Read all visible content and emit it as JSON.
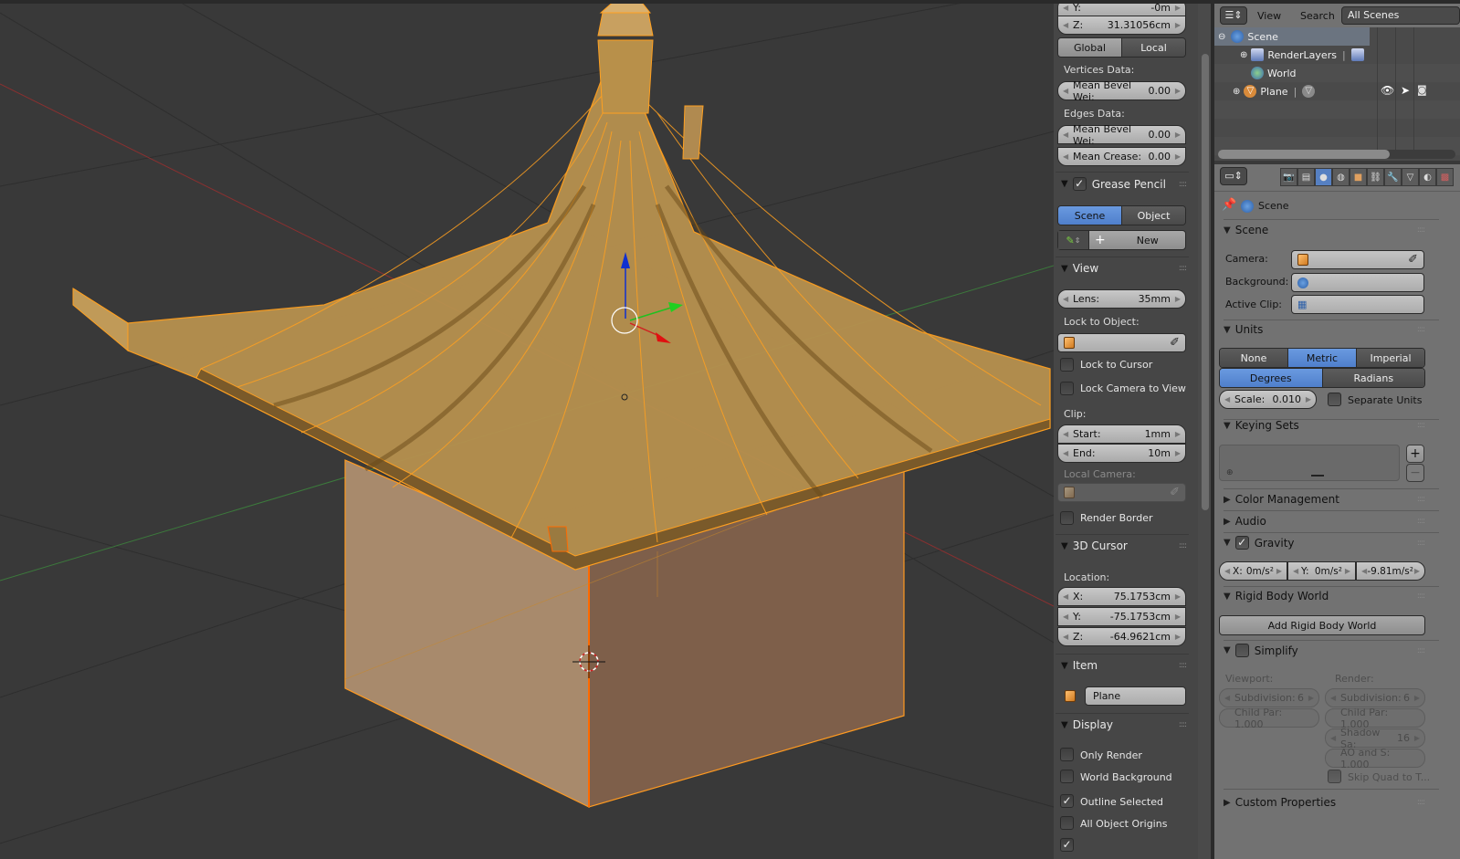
{
  "npanel": {
    "transform": {
      "y_label": "Y:",
      "y_value": "-0m",
      "z_label": "Z:",
      "z_value": "31.31056cm",
      "space_options": [
        "Global",
        "Local"
      ],
      "space_selected": "Local",
      "vertices_data_label": "Vertices Data:",
      "vertex_mean_bevel_label": "Mean Bevel Wei:",
      "vertex_mean_bevel_value": "0.00",
      "edges_data_label": "Edges Data:",
      "edge_mean_bevel_label": "Mean Bevel Wei:",
      "edge_mean_bevel_value": "0.00",
      "mean_crease_label": "Mean Crease:",
      "mean_crease_value": "0.00"
    },
    "grease_pencil": {
      "title": "Grease Pencil",
      "enabled": true,
      "source_options": [
        "Scene",
        "Object"
      ],
      "source_selected": "Scene",
      "new_label": "New"
    },
    "view": {
      "title": "View",
      "lens_label": "Lens:",
      "lens_value": "35mm",
      "lock_to_object_label": "Lock to Object:",
      "lock_to_cursor_label": "Lock to Cursor",
      "lock_to_cursor": false,
      "lock_camera_label": "Lock Camera to View",
      "lock_camera": false,
      "clip_label": "Clip:",
      "clip_start_label": "Start:",
      "clip_start_value": "1mm",
      "clip_end_label": "End:",
      "clip_end_value": "10m",
      "local_camera_label": "Local Camera:",
      "render_border_label": "Render Border",
      "render_border": false
    },
    "cursor": {
      "title": "3D Cursor",
      "location_label": "Location:",
      "x_label": "X:",
      "x_value": "75.1753cm",
      "y_label": "Y:",
      "y_value": "-75.1753cm",
      "z_label": "Z:",
      "z_value": "-64.9621cm"
    },
    "item": {
      "title": "Item",
      "name": "Plane"
    },
    "display": {
      "title": "Display",
      "only_render_label": "Only Render",
      "only_render": false,
      "world_background_label": "World Background",
      "world_background": false,
      "outline_selected_label": "Outline Selected",
      "outline_selected": true,
      "all_object_origins_label": "All Object Origins",
      "all_object_origins": false
    }
  },
  "outliner": {
    "view_label": "View",
    "search_label": "Search",
    "display_mode": "All Scenes",
    "items": [
      {
        "name": "Scene",
        "level": 0,
        "expanded": true
      },
      {
        "name": "RenderLayers",
        "level": 1,
        "expanded": false
      },
      {
        "name": "World",
        "level": 1
      },
      {
        "name": "Plane",
        "level": 1,
        "expanded": false
      }
    ]
  },
  "properties": {
    "tabs": [
      "render",
      "render-layers",
      "scene",
      "world",
      "object",
      "constraints",
      "modifiers",
      "data",
      "material",
      "texture"
    ],
    "active_tab": "scene",
    "breadcrumb": "Scene",
    "scene_panel": {
      "title": "Scene",
      "camera_label": "Camera:",
      "background_label": "Background:",
      "active_clip_label": "Active Clip:"
    },
    "units": {
      "title": "Units",
      "system_options": [
        "None",
        "Metric",
        "Imperial"
      ],
      "system_selected": "Metric",
      "rotation_options": [
        "Degrees",
        "Radians"
      ],
      "rotation_selected": "Degrees",
      "scale_label": "Scale:",
      "scale_value": "0.010",
      "separate_units_label": "Separate Units",
      "separate_units": false
    },
    "keying_sets": {
      "title": "Keying Sets"
    },
    "color_management": {
      "title": "Color Management"
    },
    "audio": {
      "title": "Audio"
    },
    "gravity": {
      "title": "Gravity",
      "enabled": true,
      "x_label": "X:",
      "x_value": "0m/s²",
      "y_label": "Y:",
      "y_value": "0m/s²",
      "z_value": "-9.81m/s²"
    },
    "rigid_body_world": {
      "title": "Rigid Body World",
      "add_label": "Add Rigid Body World"
    },
    "simplify": {
      "title": "Simplify",
      "enabled": false,
      "viewport_label": "Viewport:",
      "render_label": "Render:",
      "vp_subdivision_label": "Subdivision:",
      "vp_subdivision_value": "6",
      "vp_child_par": "Child Par: 1.000",
      "r_subdivision_label": "Subdivision:",
      "r_subdivision_value": "6",
      "r_child_par": "Child Par: 1.000",
      "r_shadow_label": "Shadow Sa:",
      "r_shadow_value": "16",
      "r_ao": "AO and S: 1.000",
      "skip_quad_label": "Skip Quad to T...",
      "skip_quad": false
    },
    "custom_properties": {
      "title": "Custom Properties"
    }
  },
  "colors": {
    "viewport_bg": "#393939",
    "selection_orange": "#ffa020",
    "active_blue": "#5680c2",
    "axis_x": "#c83030",
    "axis_y": "#30c030",
    "axis_z": "#1030d0"
  }
}
